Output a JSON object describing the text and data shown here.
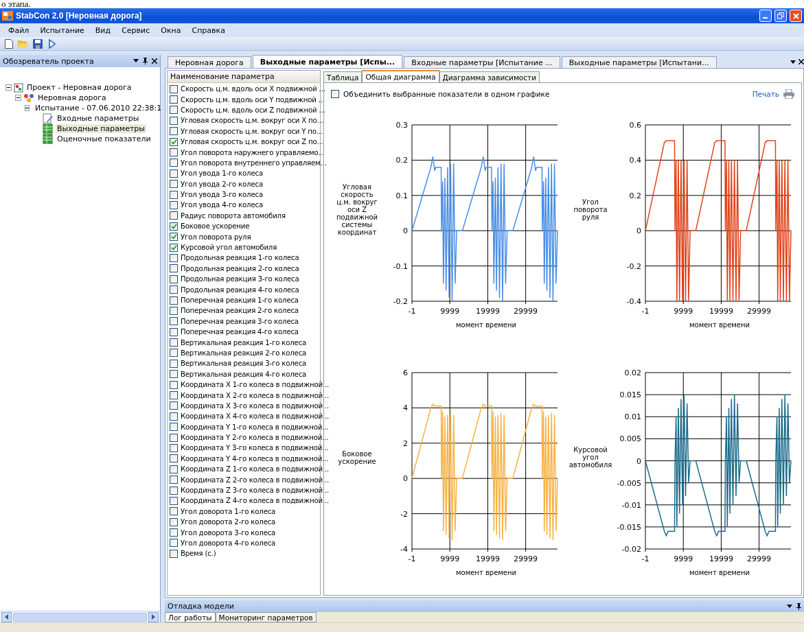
{
  "caption_fragment": "о этапа.",
  "window": {
    "title": "StabCon 2.0 [Неровная дорога]"
  },
  "menu": [
    "Файл",
    "Испытание",
    "Вид",
    "Сервис",
    "Окна",
    "Справка"
  ],
  "toolbar": [
    {
      "kind": "new"
    },
    {
      "kind": "open"
    },
    {
      "kind": "save"
    },
    {
      "kind": "run"
    }
  ],
  "project_explorer": {
    "title": "Обозреватель проекта",
    "tree": [
      {
        "label": "Проект - Неровная дорога",
        "kind": "project",
        "expanded": true,
        "selected": false,
        "children": [
          {
            "label": "Неровная дорога",
            "kind": "road",
            "expanded": true,
            "selected": false,
            "children": [
              {
                "label": "Испытание - 07.06.2010 22:38:1",
                "kind": "test",
                "expanded": true,
                "selected": false,
                "children": [
                  {
                    "label": "Входные параметры",
                    "kind": "input",
                    "selected": false
                  },
                  {
                    "label": "Выходные параметры",
                    "kind": "output",
                    "selected": true
                  },
                  {
                    "label": "Оценочные показатели",
                    "kind": "output",
                    "selected": false
                  }
                ]
              }
            ]
          }
        ]
      }
    ]
  },
  "document_tabs": [
    {
      "label": "Неровная дорога",
      "selected": false
    },
    {
      "label": "Выходные параметры [Испы...",
      "selected": true
    },
    {
      "label": "Входные параметры [Испытание ...",
      "selected": false
    },
    {
      "label": "Выходные параметры [Испытани...",
      "selected": false
    }
  ],
  "parameters": {
    "column": "Наименование параметра",
    "items": [
      {
        "label": "Скорость ц.м. вдоль оси X подвижной ...",
        "checked": false
      },
      {
        "label": "Скорость ц.м. вдоль оси Y подвижной ...",
        "checked": false
      },
      {
        "label": "Скорость ц.м. вдоль оси Z подвижной ...",
        "checked": false
      },
      {
        "label": "Угловая скорость ц.м. вокруг оси X по...",
        "checked": false
      },
      {
        "label": "Угловая скорость ц.м. вокруг оси Y по...",
        "checked": false
      },
      {
        "label": "Угловая скорость ц.м. вокруг оси Z по...",
        "checked": true
      },
      {
        "label": "Угол поворота наружнего управляемо...",
        "checked": false
      },
      {
        "label": "Угол поворота внутреннего управляем...",
        "checked": false
      },
      {
        "label": "Угол увода 1-го колеса",
        "checked": false
      },
      {
        "label": "Угол увода 2-го колеса",
        "checked": false
      },
      {
        "label": "Угол увода 3-го колеса",
        "checked": false
      },
      {
        "label": "Угол увода 4-го колеса",
        "checked": false
      },
      {
        "label": "Радиус поворота автомобиля",
        "checked": false
      },
      {
        "label": "Боковое ускорение",
        "checked": true
      },
      {
        "label": "Угол поворота руля",
        "checked": true
      },
      {
        "label": "Курсовой угол автомобиля",
        "checked": true
      },
      {
        "label": "Продольная реакция 1-го колеса",
        "checked": false
      },
      {
        "label": "Продольная реакция 2-го колеса",
        "checked": false
      },
      {
        "label": "Продольная реакция 3-го колеса",
        "checked": false
      },
      {
        "label": "Продольная реакция 4-го колеса",
        "checked": false
      },
      {
        "label": "Поперечная реакция 1-го колеса",
        "checked": false
      },
      {
        "label": "Поперечная реакция 2-го колеса",
        "checked": false
      },
      {
        "label": "Поперечная реакция 3-го колеса",
        "checked": false
      },
      {
        "label": "Поперечная реакция 4-го колеса",
        "checked": false
      },
      {
        "label": "Вертикальная реакция 1-го колеса",
        "checked": false
      },
      {
        "label": "Вертикальная реакция 2-го колеса",
        "checked": false
      },
      {
        "label": "Вертикальная реакция 3-го колеса",
        "checked": false
      },
      {
        "label": "Вертикальная реакция 4-го колеса",
        "checked": false
      },
      {
        "label": "Координата X 1-го колеса в подвижной...",
        "checked": false
      },
      {
        "label": "Координата X 2-го колеса в подвижной...",
        "checked": false
      },
      {
        "label": "Координата X 3-го колеса в подвижной...",
        "checked": false
      },
      {
        "label": "Координата X 4-го колеса в подвижной...",
        "checked": false
      },
      {
        "label": "Координата Y 1-го колеса в подвижной...",
        "checked": false
      },
      {
        "label": "Координата Y 2-го колеса в подвижной...",
        "checked": false
      },
      {
        "label": "Координата Y 3-го колеса в подвижной...",
        "checked": false
      },
      {
        "label": "Координата Y 4-го колеса в подвижной...",
        "checked": false
      },
      {
        "label": "Координата Z 1-го колеса в подвижной...",
        "checked": false
      },
      {
        "label": "Координата Z 2-го колеса в подвижной...",
        "checked": false
      },
      {
        "label": "Координата Z 3-го колеса в подвижной...",
        "checked": false
      },
      {
        "label": "Координата Z 4-го колеса в подвижной...",
        "checked": false
      },
      {
        "label": "Угол доворота 1-го колеса",
        "checked": false
      },
      {
        "label": "Угол доворота 2-го колеса",
        "checked": false
      },
      {
        "label": "Угол доворота 3-го колеса",
        "checked": false
      },
      {
        "label": "Угол доворота 4-го колеса",
        "checked": false
      },
      {
        "label": "Время (с.)",
        "checked": false
      }
    ]
  },
  "view_tabs": [
    {
      "label": "Таблица",
      "selected": false
    },
    {
      "label": "Общая диаграмма",
      "selected": true
    },
    {
      "label": "Диаграмма зависимости",
      "selected": false
    }
  ],
  "combine_option": {
    "label": "Объединить выбранные показатели в одном графике",
    "checked": false
  },
  "print_link": "Печать",
  "charts": [
    {
      "chart_data": {
        "type": "line",
        "ylabel": "Угловая скорость ц.м. вокруг оси Z подвижной системы координат",
        "xlabel": "момент времени",
        "xlim": [
          -1,
          38400
        ],
        "ylim": [
          -0.2,
          0.3
        ],
        "xticks": [
          -1,
          9999,
          19999,
          29999
        ],
        "yticks": [
          -0.2,
          -0.1,
          0,
          0.1,
          0.2,
          0.3
        ],
        "x": [
          0,
          5000,
          5500,
          6000,
          6300,
          7700,
          7800,
          8100,
          8300,
          8700,
          9000,
          9400,
          9800,
          10200,
          10600,
          11000,
          11400,
          11800,
          13300,
          18300,
          18800,
          19300,
          19600,
          21000,
          21100,
          21400,
          21600,
          22000,
          22300,
          22700,
          23100,
          23500,
          23900,
          24300,
          24700,
          25100,
          26600,
          31600,
          32100,
          32600,
          32900,
          34300,
          34400,
          34700,
          34900,
          35300,
          35600,
          36000,
          36400,
          36800,
          37200,
          37600,
          38000,
          38400
        ],
        "grid": true,
        "series": [
          {
            "color": "#4a8ee6",
            "values": [
              0,
              0.18,
              0.21,
              0.17,
              0.18,
              0.18,
              0,
              0.14,
              -0.15,
              0.15,
              -0.17,
              0.18,
              -0.19,
              0.19,
              -0.2,
              0.19,
              -0.15,
              0,
              0,
              0.18,
              0.21,
              0.17,
              0.18,
              0.18,
              0,
              0.14,
              -0.15,
              0.15,
              -0.17,
              0.18,
              -0.19,
              0.19,
              -0.2,
              0.19,
              -0.15,
              0,
              0,
              0.18,
              0.21,
              0.17,
              0.18,
              0.18,
              0,
              0.14,
              -0.15,
              0.15,
              -0.17,
              0.18,
              -0.19,
              0.19,
              -0.2,
              0.19,
              -0.15,
              0
            ]
          }
        ]
      }
    },
    {
      "chart_data": {
        "type": "line",
        "ylabel": "Угол поворота руля",
        "xlabel": "момент времени",
        "xlim": [
          -1,
          38400
        ],
        "ylim": [
          -0.4,
          0.6
        ],
        "xticks": [
          -1,
          9999,
          19999,
          29999
        ],
        "yticks": [
          -0.4,
          -0.2,
          0,
          0.2,
          0.4,
          0.6
        ],
        "x": [
          0,
          5000,
          5500,
          6000,
          6300,
          7700,
          7800,
          8100,
          8300,
          8700,
          9000,
          9400,
          9800,
          10200,
          10600,
          11000,
          11400,
          11800,
          13300,
          18300,
          18800,
          19300,
          19600,
          21000,
          21100,
          21400,
          21600,
          22000,
          22300,
          22700,
          23100,
          23500,
          23900,
          24300,
          24700,
          25100,
          26600,
          31600,
          32100,
          32600,
          32900,
          34300,
          34400,
          34700,
          34900,
          35300,
          35600,
          36000,
          36400,
          36800,
          37200,
          37600,
          38000,
          38400
        ],
        "grid": true,
        "series": [
          {
            "color": "#e0441b",
            "values": [
              0,
              0.5,
              0.51,
              0.51,
              0.51,
              0.51,
              0,
              0.4,
              -0.4,
              0.4,
              -0.4,
              0.4,
              -0.4,
              0.4,
              -0.4,
              0.4,
              -0.4,
              0,
              0,
              0.5,
              0.51,
              0.51,
              0.51,
              0.51,
              0,
              0.4,
              -0.4,
              0.4,
              -0.4,
              0.4,
              -0.4,
              0.4,
              -0.4,
              0.4,
              -0.4,
              0,
              0,
              0.5,
              0.51,
              0.51,
              0.51,
              0.51,
              0,
              0.4,
              -0.4,
              0.4,
              -0.4,
              0.4,
              -0.4,
              0.4,
              -0.4,
              0.4,
              -0.4,
              0
            ]
          }
        ]
      }
    },
    {
      "chart_data": {
        "type": "line",
        "ylabel": "Боковое ускорение",
        "xlabel": "момент времени",
        "xlim": [
          -1,
          38400
        ],
        "ylim": [
          -4,
          6
        ],
        "xticks": [
          -1,
          9999,
          19999,
          29999
        ],
        "yticks": [
          -4,
          -2,
          0,
          2,
          4,
          6
        ],
        "x": [
          0,
          5000,
          5500,
          6000,
          6300,
          7700,
          7800,
          8100,
          8300,
          8700,
          9000,
          9400,
          9800,
          10200,
          10600,
          11000,
          11400,
          11800,
          13300,
          18300,
          18800,
          19300,
          19600,
          21000,
          21100,
          21400,
          21600,
          22000,
          22300,
          22700,
          23100,
          23500,
          23900,
          24300,
          24700,
          25100,
          26600,
          31600,
          32100,
          32600,
          32900,
          34300,
          34400,
          34700,
          34900,
          35300,
          35600,
          36000,
          36400,
          36800,
          37200,
          37600,
          38000,
          38400
        ],
        "grid": true,
        "series": [
          {
            "color": "#f7b245",
            "values": [
              0,
              4,
              4.2,
              4.1,
              4.1,
              4.1,
              0,
              3.8,
              -3,
              3.5,
              -3.2,
              3.6,
              -3.4,
              3.7,
              -3.5,
              3.6,
              -3,
              0,
              0,
              4,
              4.2,
              4.1,
              4.1,
              4.1,
              0,
              3.8,
              -3,
              3.5,
              -3.2,
              3.6,
              -3.4,
              3.7,
              -3.5,
              3.6,
              -3,
              0,
              0,
              4,
              4.2,
              4.1,
              4.1,
              4.1,
              0,
              3.8,
              -3,
              3.5,
              -3.2,
              3.6,
              -3.4,
              3.7,
              -3.5,
              3.6,
              -3,
              0
            ]
          }
        ]
      }
    },
    {
      "chart_data": {
        "type": "line",
        "ylabel": "Курсовой угол автомобиля",
        "xlabel": "момент времени",
        "xlim": [
          -1,
          38400
        ],
        "ylim": [
          -0.02,
          0.02
        ],
        "xticks": [
          -1,
          9999,
          19999,
          29999
        ],
        "yticks": [
          -0.02,
          -0.015,
          -0.01,
          -0.005,
          0,
          0.005,
          0.01,
          0.015,
          0.02
        ],
        "x": [
          0,
          5000,
          5500,
          6000,
          6300,
          7700,
          7800,
          8100,
          8300,
          8700,
          9000,
          9400,
          9800,
          10200,
          10600,
          11000,
          11400,
          11800,
          13300,
          18300,
          18800,
          19300,
          19600,
          21000,
          21100,
          21400,
          21600,
          22000,
          22300,
          22700,
          23100,
          23500,
          23900,
          24300,
          24700,
          25100,
          26600,
          31600,
          32100,
          32600,
          32900,
          34300,
          34400,
          34700,
          34900,
          35300,
          35600,
          36000,
          36400,
          36800,
          37200,
          37600,
          38000,
          38400
        ],
        "grid": true,
        "series": [
          {
            "color": "#1c6b8c",
            "values": [
              0,
              -0.016,
              -0.017,
              -0.016,
              -0.016,
              -0.016,
              0,
              0.01,
              -0.015,
              0.012,
              -0.012,
              0.014,
              -0.01,
              0.015,
              -0.008,
              0.013,
              -0.005,
              0,
              0,
              -0.016,
              -0.017,
              -0.016,
              -0.016,
              -0.016,
              0,
              0.01,
              -0.015,
              0.012,
              -0.012,
              0.014,
              -0.01,
              0.015,
              -0.008,
              0.013,
              -0.005,
              0,
              0,
              -0.016,
              -0.017,
              -0.016,
              -0.016,
              -0.016,
              0,
              0.01,
              -0.015,
              0.012,
              -0.012,
              0.014,
              -0.01,
              0.015,
              -0.008,
              0.013,
              -0.005,
              0
            ]
          }
        ]
      }
    }
  ],
  "debug_panel": {
    "title": "Отладка модели",
    "tabs": [
      {
        "label": "Лог работы",
        "selected": true
      },
      {
        "label": "Мониторинг параметров",
        "selected": false
      }
    ]
  }
}
